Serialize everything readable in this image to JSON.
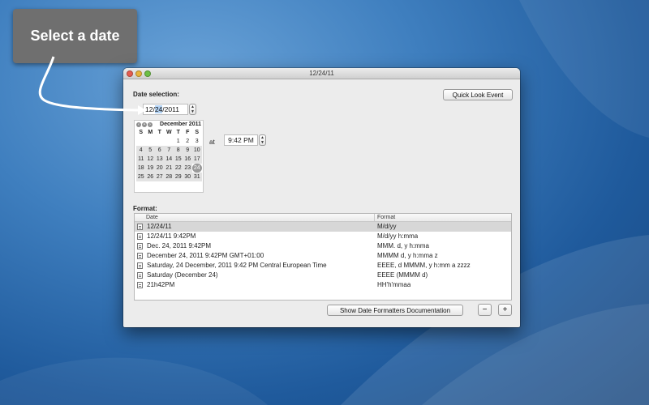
{
  "callout": {
    "text": "Select a date"
  },
  "window": {
    "title": "12/24/11"
  },
  "date_selection": {
    "label": "Date selection:",
    "date_month": "12/",
    "date_day": "24",
    "date_year": "/2011",
    "quick_look_label": "Quick Look Event"
  },
  "calendar": {
    "month_label": "December 2011",
    "weekdays": [
      "S",
      "M",
      "T",
      "W",
      "T",
      "F",
      "S"
    ],
    "days": [
      "",
      "",
      "",
      "",
      "1",
      "2",
      "3",
      "4",
      "5",
      "6",
      "7",
      "8",
      "9",
      "10",
      "11",
      "12",
      "13",
      "14",
      "15",
      "16",
      "17",
      "18",
      "19",
      "20",
      "21",
      "22",
      "23",
      "24",
      "25",
      "26",
      "27",
      "28",
      "29",
      "30",
      "31"
    ],
    "selected_day": "24"
  },
  "time": {
    "at_label": "at",
    "value": "9:42 PM"
  },
  "format": {
    "label": "Format:",
    "columns": [
      "Date",
      "Format"
    ],
    "rows": [
      {
        "date": "12/24/11",
        "format": "M/d/yy"
      },
      {
        "date": "12/24/11 9:42PM",
        "format": "M/d/yy h:mma"
      },
      {
        "date": "Dec. 24, 2011 9:42PM",
        "format": "MMM. d, y h:mma"
      },
      {
        "date": "December 24, 2011 9:42PM GMT+01:00",
        "format": "MMMM d, y h:mma z"
      },
      {
        "date": "Saturday, 24 December, 2011 9:42 PM Central European Time",
        "format": "EEEE, d MMMM, y h:mm a zzzz"
      },
      {
        "date": "Saturday (December 24)",
        "format": "EEEE (MMMM d)"
      },
      {
        "date": "21h42PM",
        "format": "HH'h'mmaa"
      }
    ],
    "selected_row": 0
  },
  "footer": {
    "docs_label": "Show Date Formatters Documentation",
    "minus_label": "−",
    "plus_label": "+"
  },
  "colors": {
    "background": "#3f7fbf",
    "callout": "#6f6f6f",
    "window": "#ececec"
  }
}
